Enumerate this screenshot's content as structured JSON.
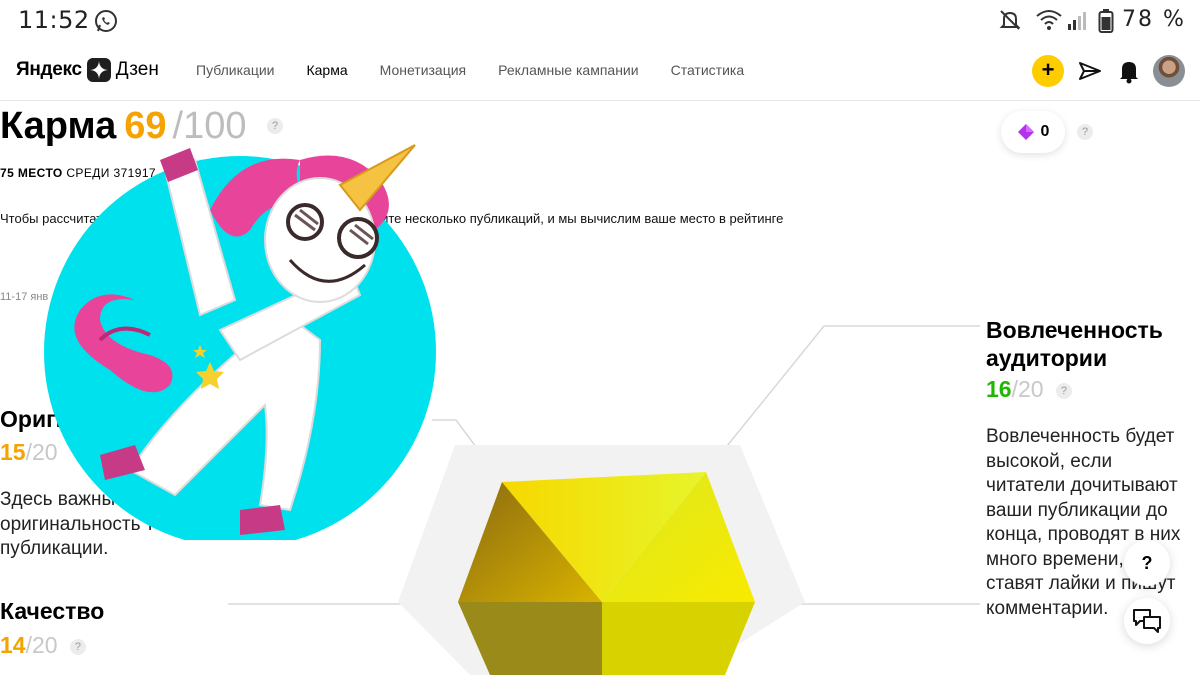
{
  "status_bar": {
    "time": "11:52",
    "battery_text": "78 %",
    "icons": [
      "whatsapp-icon",
      "mute-icon",
      "wifi-icon",
      "signal-icon",
      "battery-icon"
    ]
  },
  "header": {
    "logo_yandex": "Яндекс",
    "logo_zen": "Дзен",
    "nav": [
      {
        "label": "Публикации",
        "active": false
      },
      {
        "label": "Карма",
        "active": true
      },
      {
        "label": "Монетизация",
        "active": false
      },
      {
        "label": "Рекламные кампании",
        "active": false
      },
      {
        "label": "Статистика",
        "active": false
      }
    ],
    "add_label": "+"
  },
  "karma": {
    "title": "Карма",
    "score": "69",
    "max": "/100",
    "rank_place": "75 МЕСТО",
    "rank_rest": " СРЕДИ 371917",
    "description": "Чтобы рассчитать … успехи с успехами других авторов. Сделайте несколько публикаций, и мы вычислим ваше место в рейтинге",
    "period": "11-17 янв",
    "gem_count": "0"
  },
  "metrics": {
    "engagement": {
      "title": "Вовлеченность аудитории",
      "score": "16",
      "den": "/20",
      "text": "Вовлеченность будет высокой, если читатели дочитывают ваши публикации до конца, проводят в них много времени, ставят лайки и пишут комментарии."
    },
    "originality": {
      "title": "Оригинальность",
      "score": "15",
      "den": "/20",
      "text": "Здесь важны оригинальность текста публикации."
    },
    "quality": {
      "title": "Качество",
      "score": "14",
      "den": "/20"
    }
  },
  "floating": {
    "help_label": "?"
  },
  "colors": {
    "accent_yellow": "#ffcc00",
    "score_orange": "#f5a300",
    "score_green": "#1fb800",
    "unicorn_circle": "#00e1ee"
  }
}
